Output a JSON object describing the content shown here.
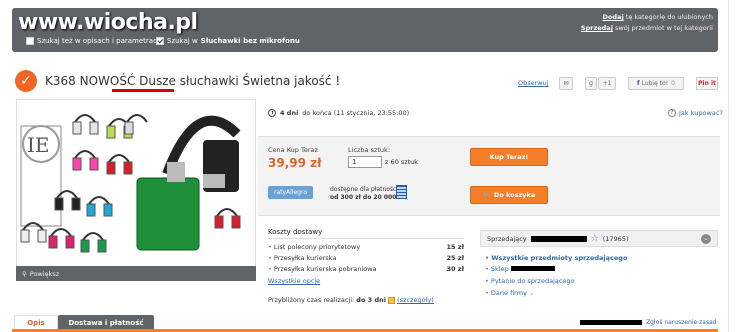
{
  "header": {
    "watermark": "www.wiocha.pl",
    "search_in_desc": "Szukaj też w opisach i parametrach",
    "search_in_category_prefix": "Szukaj w",
    "search_in_category_name": "Słuchawki bez mikrofonu",
    "add_fav_link": "Dodaj",
    "add_fav_text": "tę kategorię do ulubionych",
    "sell_link": "Sprzedaj",
    "sell_text": "swój przedmiot w tej kategorii"
  },
  "item": {
    "title_prefix": "K368 NOWOŚĆ",
    "title_highlight": "Dusze słuchawki",
    "title_suffix": "Świetna jakość !",
    "observe": "Obserwuj",
    "like_button": "Lubię to!",
    "gplus": "+1",
    "pinit": "Pin it",
    "zoom": "Powiększ"
  },
  "timing": {
    "ends_bold": "4 dni",
    "ends_rest": "do końca (11 stycznia, 23:55:00)",
    "ask": "Jak kupować?"
  },
  "buy": {
    "price_label": "Cena Kup Teraz",
    "price": "39,99 zł",
    "qty_label": "Liczba sztuk:",
    "qty_value": "1",
    "qty_of": "z 60 sztuk",
    "buy_now": "Kup Teraz!",
    "raty_badge": "ratyAllegro",
    "pay_line1": "dostępne dla płatności",
    "pay_line2": "od 300 zł do 20 000 zł",
    "to_cart": "Do koszyka"
  },
  "shipping": {
    "title": "Koszty dostawy",
    "rows": [
      {
        "name": "List polecony priorytetowy",
        "price": "15 zł"
      },
      {
        "name": "Przesyłka kurierska",
        "price": "25 zł"
      },
      {
        "name": "Przesyłka kurierska pobraniowa",
        "price": "30 zł"
      }
    ],
    "all_options": "Wszystkie opcje",
    "realiz_prefix": "Przybliżony czas realizacji:",
    "realiz_bold": "do 3 dni",
    "realiz_link": "(szczegóły)"
  },
  "seller": {
    "label": "Sprzedający",
    "rating": "(17965)",
    "links": [
      "Wszystkie przedmioty sprzedającego",
      "Sklep",
      "Pytanie do sprzedającego",
      "Dane firmy"
    ]
  },
  "tabs": {
    "tab1": "Opis",
    "tab2": "Dostawa i płatność"
  },
  "report": "Zgłoś naruszenie zasad",
  "colors": {
    "accent": "#f57f29",
    "link": "#3366aa",
    "price": "#e2632a"
  }
}
